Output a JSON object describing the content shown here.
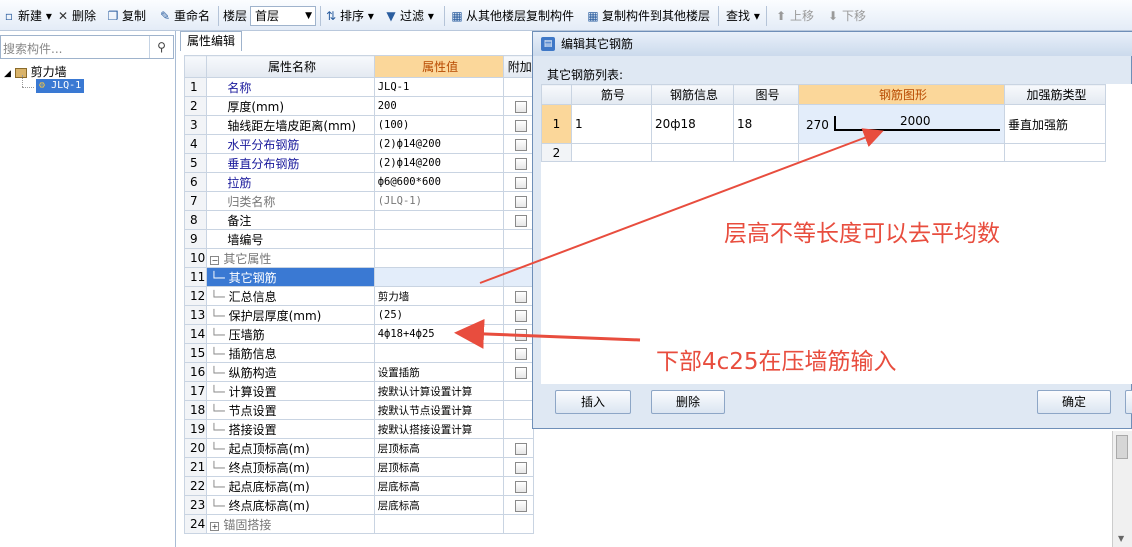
{
  "toolbar": {
    "new_label": "新建",
    "delete_label": "删除",
    "copy_label": "复制",
    "rename_label": "重命名",
    "floor_label": "楼层",
    "floor_value": "首层",
    "sort_label": "排序",
    "filter_label": "过滤",
    "copy_from_floor_label": "从其他楼层复制构件",
    "copy_to_floor_label": "复制构件到其他楼层",
    "find_label": "查找",
    "move_up_label": "上移",
    "move_down_label": "下移"
  },
  "left_panel": {
    "search_placeholder": "搜索构件...",
    "tree_root": "剪力墙",
    "tree_child": "JLQ-1"
  },
  "property_panel": {
    "tab_label": "属性编辑",
    "headers": [
      "属性名称",
      "属性值",
      "附加"
    ],
    "rows": [
      {
        "num": "1",
        "name": "名称",
        "value": "JLQ-1",
        "style": "blue",
        "check": false
      },
      {
        "num": "2",
        "name": "厚度(mm)",
        "value": "200",
        "style": "",
        "check": true
      },
      {
        "num": "3",
        "name": "轴线距左墙皮距离(mm)",
        "value": "(100)",
        "style": "",
        "check": true
      },
      {
        "num": "4",
        "name": "水平分布钢筋",
        "value": "(2)ф14@200",
        "style": "blue",
        "check": true
      },
      {
        "num": "5",
        "name": "垂直分布钢筋",
        "value": "(2)ф14@200",
        "style": "blue",
        "check": true
      },
      {
        "num": "6",
        "name": "拉筋",
        "value": "ф6@600*600",
        "style": "blue",
        "check": true
      },
      {
        "num": "7",
        "name": "归类名称",
        "value": "(JLQ-1)",
        "style": "gray",
        "check": true
      },
      {
        "num": "8",
        "name": "备注",
        "value": "",
        "style": "",
        "check": true
      },
      {
        "num": "9",
        "name": "墙编号",
        "value": "",
        "style": "",
        "check": false
      },
      {
        "num": "10",
        "name": "其它属性",
        "value": "",
        "style": "group",
        "check": false
      },
      {
        "num": "11",
        "name": "其它钢筋",
        "value": "",
        "style": "selected",
        "check": false
      },
      {
        "num": "12",
        "name": "汇总信息",
        "value": "剪力墙",
        "style": "sub",
        "check": true
      },
      {
        "num": "13",
        "name": "保护层厚度(mm)",
        "value": "(25)",
        "style": "sub",
        "check": true
      },
      {
        "num": "14",
        "name": "压墙筋",
        "value": "4ф18+4ф25",
        "style": "sub",
        "check": true
      },
      {
        "num": "15",
        "name": "插筋信息",
        "value": "",
        "style": "sub",
        "check": true
      },
      {
        "num": "16",
        "name": "纵筋构造",
        "value": "设置插筋",
        "style": "sub",
        "check": true
      },
      {
        "num": "17",
        "name": "计算设置",
        "value": "按默认计算设置计算",
        "style": "sub",
        "check": false
      },
      {
        "num": "18",
        "name": "节点设置",
        "value": "按默认节点设置计算",
        "style": "sub",
        "check": false
      },
      {
        "num": "19",
        "name": "搭接设置",
        "value": "按默认搭接设置计算",
        "style": "sub",
        "check": false
      },
      {
        "num": "20",
        "name": "起点顶标高(m)",
        "value": "层顶标高",
        "style": "sub",
        "check": true
      },
      {
        "num": "21",
        "name": "终点顶标高(m)",
        "value": "层顶标高",
        "style": "sub",
        "check": true
      },
      {
        "num": "22",
        "name": "起点底标高(m)",
        "value": "层底标高",
        "style": "sub",
        "check": true
      },
      {
        "num": "23",
        "name": "终点底标高(m)",
        "value": "层底标高",
        "style": "sub",
        "check": true
      },
      {
        "num": "24",
        "name": "锚固搭接",
        "value": "",
        "style": "group",
        "check": false
      }
    ]
  },
  "dialog": {
    "title": "编辑其它钢筋",
    "list_label": "其它钢筋列表:",
    "headers": [
      "筋号",
      "钢筋信息",
      "图号",
      "钢筋图形",
      "加强筋类型"
    ],
    "rows": [
      {
        "num": "1",
        "bar_no": "1",
        "info": "20ф18",
        "fig_no": "18",
        "shape_left": "270",
        "shape_len": "2000",
        "type": "垂直加强筋"
      },
      {
        "num": "2",
        "bar_no": "",
        "info": "",
        "fig_no": "",
        "shape_left": "",
        "shape_len": "",
        "type": ""
      }
    ],
    "insert_label": "插入",
    "delete_label": "删除",
    "ok_label": "确定"
  },
  "annotations": {
    "note1": "层高不等长度可以去平均数",
    "note2": "下部4c25在压墙筋输入",
    "color": "#e84d3e"
  }
}
